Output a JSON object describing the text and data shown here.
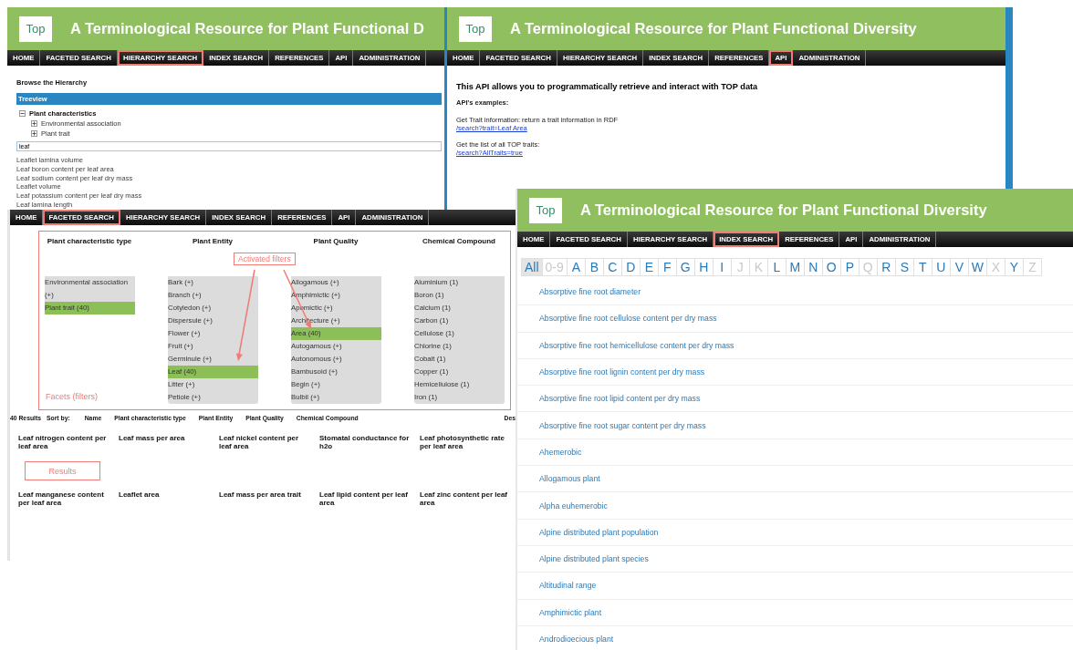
{
  "hierarchy_page": {
    "logo": "Top",
    "title": "A Terminological Resource for Plant Functional D",
    "nav": [
      {
        "label": "HOME",
        "selected": false
      },
      {
        "label": "FACETED SEARCH",
        "selected": false
      },
      {
        "label": "HIERARCHY SEARCH",
        "selected": true
      },
      {
        "label": "INDEX SEARCH",
        "selected": false
      },
      {
        "label": "REFERENCES",
        "selected": false
      },
      {
        "label": "API",
        "selected": false
      },
      {
        "label": "ADMINISTRATION",
        "selected": false
      }
    ],
    "heading": "Browse the Hierarchy",
    "treeview_title": "Treeview",
    "tree": [
      {
        "label": "Plant characteristics",
        "expanded": true,
        "children": [
          {
            "label": "Environmental association",
            "expanded": false
          },
          {
            "label": "Plant trait",
            "expanded": false
          }
        ]
      }
    ],
    "search": {
      "value": "leaf"
    },
    "suggestions": [
      "Leaflet lamina volume",
      "Leaf boron content per leaf area",
      "Leaf sodium content per leaf dry mass",
      "Leaflet volume",
      "Leaf potassium content per leaf dry mass",
      "Leaf lamina length"
    ]
  },
  "api_page": {
    "logo": "Top",
    "title": "A Terminological Resource for Plant Functional Diversity",
    "nav": [
      {
        "label": "HOME",
        "selected": false
      },
      {
        "label": "FACETED SEARCH",
        "selected": false
      },
      {
        "label": "HIERARCHY SEARCH",
        "selected": false
      },
      {
        "label": "INDEX SEARCH",
        "selected": false
      },
      {
        "label": "REFERENCES",
        "selected": false
      },
      {
        "label": "API",
        "selected": true
      },
      {
        "label": "ADMINISTRATION",
        "selected": false
      }
    ],
    "intro": "This API allows you to programmatically retrieve and interact with TOP data",
    "examples_heading": "API's examples:",
    "examples": [
      {
        "text": "Get Trait information: return a trait information in RDF",
        "link": "/search?trait=Leaf Area"
      },
      {
        "text": "Get the list of all TOP traits:",
        "link": "/search?AllTraits=true"
      }
    ]
  },
  "faceted_page": {
    "nav": [
      {
        "label": "HOME",
        "selected": false
      },
      {
        "label": "FACETED SEARCH",
        "selected": true
      },
      {
        "label": "HIERARCHY SEARCH",
        "selected": false
      },
      {
        "label": "INDEX SEARCH",
        "selected": false
      },
      {
        "label": "REFERENCES",
        "selected": false
      },
      {
        "label": "API",
        "selected": false
      },
      {
        "label": "ADMINISTRATION",
        "selected": false
      }
    ],
    "facets": [
      {
        "title": "Plant characteristic type",
        "items": [
          {
            "label": "Environmental association (+)",
            "selected": false
          },
          {
            "label": "Plant trait (40)",
            "selected": true
          }
        ]
      },
      {
        "title": "Plant Entity",
        "items": [
          {
            "label": "Bark (+)",
            "selected": false
          },
          {
            "label": "Branch (+)",
            "selected": false
          },
          {
            "label": "Cotyledon (+)",
            "selected": false
          },
          {
            "label": "Dispersule (+)",
            "selected": false
          },
          {
            "label": "Flower (+)",
            "selected": false
          },
          {
            "label": "Fruit (+)",
            "selected": false
          },
          {
            "label": "Germinule (+)",
            "selected": false
          },
          {
            "label": "Leaf (40)",
            "selected": true
          },
          {
            "label": "Litter (+)",
            "selected": false
          },
          {
            "label": "Petiole (+)",
            "selected": false
          }
        ]
      },
      {
        "title": "Plant Quality",
        "items": [
          {
            "label": "Allogamous (+)",
            "selected": false
          },
          {
            "label": "Amphimictic (+)",
            "selected": false
          },
          {
            "label": "Apomictic (+)",
            "selected": false
          },
          {
            "label": "Architecture (+)",
            "selected": false
          },
          {
            "label": "Area (40)",
            "selected": true
          },
          {
            "label": "Autogamous (+)",
            "selected": false
          },
          {
            "label": "Autonomous (+)",
            "selected": false
          },
          {
            "label": "Bambusoid (+)",
            "selected": false
          },
          {
            "label": "Begin (+)",
            "selected": false
          },
          {
            "label": "Bulbil (+)",
            "selected": false
          }
        ]
      },
      {
        "title": "Chemical Compound",
        "items": [
          {
            "label": "Aluminium (1)",
            "selected": false
          },
          {
            "label": "Boron (1)",
            "selected": false
          },
          {
            "label": "Calcium (1)",
            "selected": false
          },
          {
            "label": "Carbon (1)",
            "selected": false
          },
          {
            "label": "Cellulose (1)",
            "selected": false
          },
          {
            "label": "Chlorine (1)",
            "selected": false
          },
          {
            "label": "Cobalt (1)",
            "selected": false
          },
          {
            "label": "Copper (1)",
            "selected": false
          },
          {
            "label": "Hemicellulose (1)",
            "selected": false
          },
          {
            "label": "Iron (1)",
            "selected": false
          }
        ]
      }
    ],
    "annotations": {
      "activated_filters": "Activated filters",
      "facets": "Facets (filters)",
      "results": "Results"
    },
    "result_count": "40 Results",
    "sort_label": "Sort by:",
    "sort_options": [
      "Name",
      "Plant characteristic type",
      "Plant Entity",
      "Plant Quality",
      "Chemical Compound",
      "Des"
    ],
    "results": [
      "Leaf nitrogen content per leaf area",
      "Leaf mass per area",
      "Leaf nickel content per leaf area",
      "Stomatal conductance for h2o",
      "Leaf photosynthetic rate per leaf area",
      "Leaf manganese content per leaf area",
      "Leaflet area",
      "Leaf mass per area trait",
      "Leaf lipid content per leaf area",
      "Leaf zinc content per leaf area"
    ]
  },
  "index_page": {
    "logo": "Top",
    "title": "A Terminological Resource for Plant Functional Diversity",
    "nav": [
      {
        "label": "HOME",
        "selected": false
      },
      {
        "label": "FACETED SEARCH",
        "selected": false
      },
      {
        "label": "HIERARCHY SEARCH",
        "selected": false
      },
      {
        "label": "INDEX SEARCH",
        "selected": true
      },
      {
        "label": "REFERENCES",
        "selected": false
      },
      {
        "label": "API",
        "selected": false
      },
      {
        "label": "ADMINISTRATION",
        "selected": false
      }
    ],
    "letters": [
      {
        "label": "All",
        "selected": true,
        "disabled": false
      },
      {
        "label": "0-9",
        "selected": false,
        "disabled": true
      },
      {
        "label": "A",
        "selected": false,
        "disabled": false
      },
      {
        "label": "B",
        "selected": false,
        "disabled": false
      },
      {
        "label": "C",
        "selected": false,
        "disabled": false
      },
      {
        "label": "D",
        "selected": false,
        "disabled": false
      },
      {
        "label": "E",
        "selected": false,
        "disabled": false
      },
      {
        "label": "F",
        "selected": false,
        "disabled": false
      },
      {
        "label": "G",
        "selected": false,
        "disabled": false
      },
      {
        "label": "H",
        "selected": false,
        "disabled": false
      },
      {
        "label": "I",
        "selected": false,
        "disabled": false
      },
      {
        "label": "J",
        "selected": false,
        "disabled": true
      },
      {
        "label": "K",
        "selected": false,
        "disabled": true
      },
      {
        "label": "L",
        "selected": false,
        "disabled": false
      },
      {
        "label": "M",
        "selected": false,
        "disabled": false
      },
      {
        "label": "N",
        "selected": false,
        "disabled": false
      },
      {
        "label": "O",
        "selected": false,
        "disabled": false
      },
      {
        "label": "P",
        "selected": false,
        "disabled": false
      },
      {
        "label": "Q",
        "selected": false,
        "disabled": true
      },
      {
        "label": "R",
        "selected": false,
        "disabled": false
      },
      {
        "label": "S",
        "selected": false,
        "disabled": false
      },
      {
        "label": "T",
        "selected": false,
        "disabled": false
      },
      {
        "label": "U",
        "selected": false,
        "disabled": false
      },
      {
        "label": "V",
        "selected": false,
        "disabled": false
      },
      {
        "label": "W",
        "selected": false,
        "disabled": false
      },
      {
        "label": "X",
        "selected": false,
        "disabled": true
      },
      {
        "label": "Y",
        "selected": false,
        "disabled": false
      },
      {
        "label": "Z",
        "selected": false,
        "disabled": true
      }
    ],
    "terms": [
      "Absorptive fine root diameter",
      "Absorptive fine root cellulose content per dry mass",
      "Absorptive fine root hemicellulose content per dry mass",
      "Absorptive fine root lignin content per dry mass",
      "Absorptive fine root lipid content per dry mass",
      "Absorptive fine root sugar content per dry mass",
      "Ahemerobic",
      "Allogamous plant",
      "Alpha euhemerobic",
      "Alpine distributed plant population",
      "Alpine distributed plant species",
      "Altitudinal range",
      "Amphimictic plant",
      "Androdioecious plant"
    ]
  }
}
